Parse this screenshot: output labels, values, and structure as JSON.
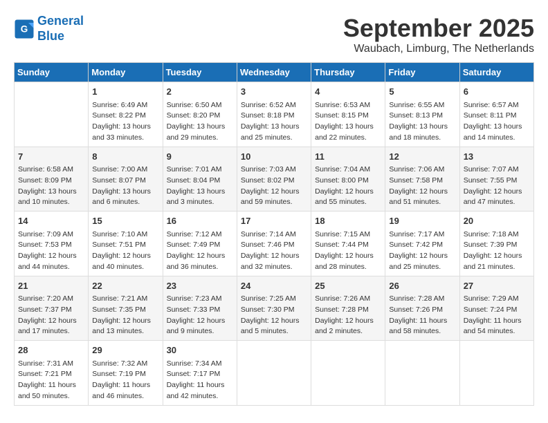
{
  "header": {
    "logo_line1": "General",
    "logo_line2": "Blue",
    "month_title": "September 2025",
    "subtitle": "Waubach, Limburg, The Netherlands"
  },
  "days_of_week": [
    "Sunday",
    "Monday",
    "Tuesday",
    "Wednesday",
    "Thursday",
    "Friday",
    "Saturday"
  ],
  "weeks": [
    [
      {
        "day": "",
        "info": ""
      },
      {
        "day": "1",
        "info": "Sunrise: 6:49 AM\nSunset: 8:22 PM\nDaylight: 13 hours and 33 minutes."
      },
      {
        "day": "2",
        "info": "Sunrise: 6:50 AM\nSunset: 8:20 PM\nDaylight: 13 hours and 29 minutes."
      },
      {
        "day": "3",
        "info": "Sunrise: 6:52 AM\nSunset: 8:18 PM\nDaylight: 13 hours and 25 minutes."
      },
      {
        "day": "4",
        "info": "Sunrise: 6:53 AM\nSunset: 8:15 PM\nDaylight: 13 hours and 22 minutes."
      },
      {
        "day": "5",
        "info": "Sunrise: 6:55 AM\nSunset: 8:13 PM\nDaylight: 13 hours and 18 minutes."
      },
      {
        "day": "6",
        "info": "Sunrise: 6:57 AM\nSunset: 8:11 PM\nDaylight: 13 hours and 14 minutes."
      }
    ],
    [
      {
        "day": "7",
        "info": "Sunrise: 6:58 AM\nSunset: 8:09 PM\nDaylight: 13 hours and 10 minutes."
      },
      {
        "day": "8",
        "info": "Sunrise: 7:00 AM\nSunset: 8:07 PM\nDaylight: 13 hours and 6 minutes."
      },
      {
        "day": "9",
        "info": "Sunrise: 7:01 AM\nSunset: 8:04 PM\nDaylight: 13 hours and 3 minutes."
      },
      {
        "day": "10",
        "info": "Sunrise: 7:03 AM\nSunset: 8:02 PM\nDaylight: 12 hours and 59 minutes."
      },
      {
        "day": "11",
        "info": "Sunrise: 7:04 AM\nSunset: 8:00 PM\nDaylight: 12 hours and 55 minutes."
      },
      {
        "day": "12",
        "info": "Sunrise: 7:06 AM\nSunset: 7:58 PM\nDaylight: 12 hours and 51 minutes."
      },
      {
        "day": "13",
        "info": "Sunrise: 7:07 AM\nSunset: 7:55 PM\nDaylight: 12 hours and 47 minutes."
      }
    ],
    [
      {
        "day": "14",
        "info": "Sunrise: 7:09 AM\nSunset: 7:53 PM\nDaylight: 12 hours and 44 minutes."
      },
      {
        "day": "15",
        "info": "Sunrise: 7:10 AM\nSunset: 7:51 PM\nDaylight: 12 hours and 40 minutes."
      },
      {
        "day": "16",
        "info": "Sunrise: 7:12 AM\nSunset: 7:49 PM\nDaylight: 12 hours and 36 minutes."
      },
      {
        "day": "17",
        "info": "Sunrise: 7:14 AM\nSunset: 7:46 PM\nDaylight: 12 hours and 32 minutes."
      },
      {
        "day": "18",
        "info": "Sunrise: 7:15 AM\nSunset: 7:44 PM\nDaylight: 12 hours and 28 minutes."
      },
      {
        "day": "19",
        "info": "Sunrise: 7:17 AM\nSunset: 7:42 PM\nDaylight: 12 hours and 25 minutes."
      },
      {
        "day": "20",
        "info": "Sunrise: 7:18 AM\nSunset: 7:39 PM\nDaylight: 12 hours and 21 minutes."
      }
    ],
    [
      {
        "day": "21",
        "info": "Sunrise: 7:20 AM\nSunset: 7:37 PM\nDaylight: 12 hours and 17 minutes."
      },
      {
        "day": "22",
        "info": "Sunrise: 7:21 AM\nSunset: 7:35 PM\nDaylight: 12 hours and 13 minutes."
      },
      {
        "day": "23",
        "info": "Sunrise: 7:23 AM\nSunset: 7:33 PM\nDaylight: 12 hours and 9 minutes."
      },
      {
        "day": "24",
        "info": "Sunrise: 7:25 AM\nSunset: 7:30 PM\nDaylight: 12 hours and 5 minutes."
      },
      {
        "day": "25",
        "info": "Sunrise: 7:26 AM\nSunset: 7:28 PM\nDaylight: 12 hours and 2 minutes."
      },
      {
        "day": "26",
        "info": "Sunrise: 7:28 AM\nSunset: 7:26 PM\nDaylight: 11 hours and 58 minutes."
      },
      {
        "day": "27",
        "info": "Sunrise: 7:29 AM\nSunset: 7:24 PM\nDaylight: 11 hours and 54 minutes."
      }
    ],
    [
      {
        "day": "28",
        "info": "Sunrise: 7:31 AM\nSunset: 7:21 PM\nDaylight: 11 hours and 50 minutes."
      },
      {
        "day": "29",
        "info": "Sunrise: 7:32 AM\nSunset: 7:19 PM\nDaylight: 11 hours and 46 minutes."
      },
      {
        "day": "30",
        "info": "Sunrise: 7:34 AM\nSunset: 7:17 PM\nDaylight: 11 hours and 42 minutes."
      },
      {
        "day": "",
        "info": ""
      },
      {
        "day": "",
        "info": ""
      },
      {
        "day": "",
        "info": ""
      },
      {
        "day": "",
        "info": ""
      }
    ]
  ]
}
